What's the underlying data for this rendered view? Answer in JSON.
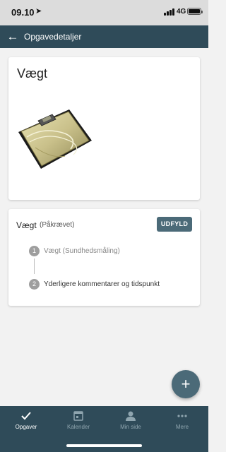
{
  "status_bar": {
    "time": "09.10",
    "network": "4G"
  },
  "app_bar": {
    "title": "Opgavedetaljer"
  },
  "task_card": {
    "title": "Vægt"
  },
  "form_card": {
    "title": "Vægt",
    "subtitle": "(Påkrævet)",
    "fill_button": "UDFYLD",
    "steps": [
      {
        "number": "1",
        "label": "Vægt (Sundhedsmåling)"
      },
      {
        "number": "2",
        "label": "Yderligere kommentarer og tidspunkt"
      }
    ]
  },
  "fab": {
    "icon": "plus-icon",
    "label": "+"
  },
  "bottom_nav": {
    "items": [
      {
        "label": "Opgaver",
        "icon": "checkmark-icon",
        "active": true
      },
      {
        "label": "Kalender",
        "icon": "calendar-icon",
        "active": false
      },
      {
        "label": "Min side",
        "icon": "person-icon",
        "active": false
      },
      {
        "label": "Mere",
        "icon": "more-dots-icon",
        "active": false
      }
    ]
  },
  "colors": {
    "primary": "#2f4b59",
    "button": "#4b6a78",
    "background": "#f2f2f2"
  }
}
